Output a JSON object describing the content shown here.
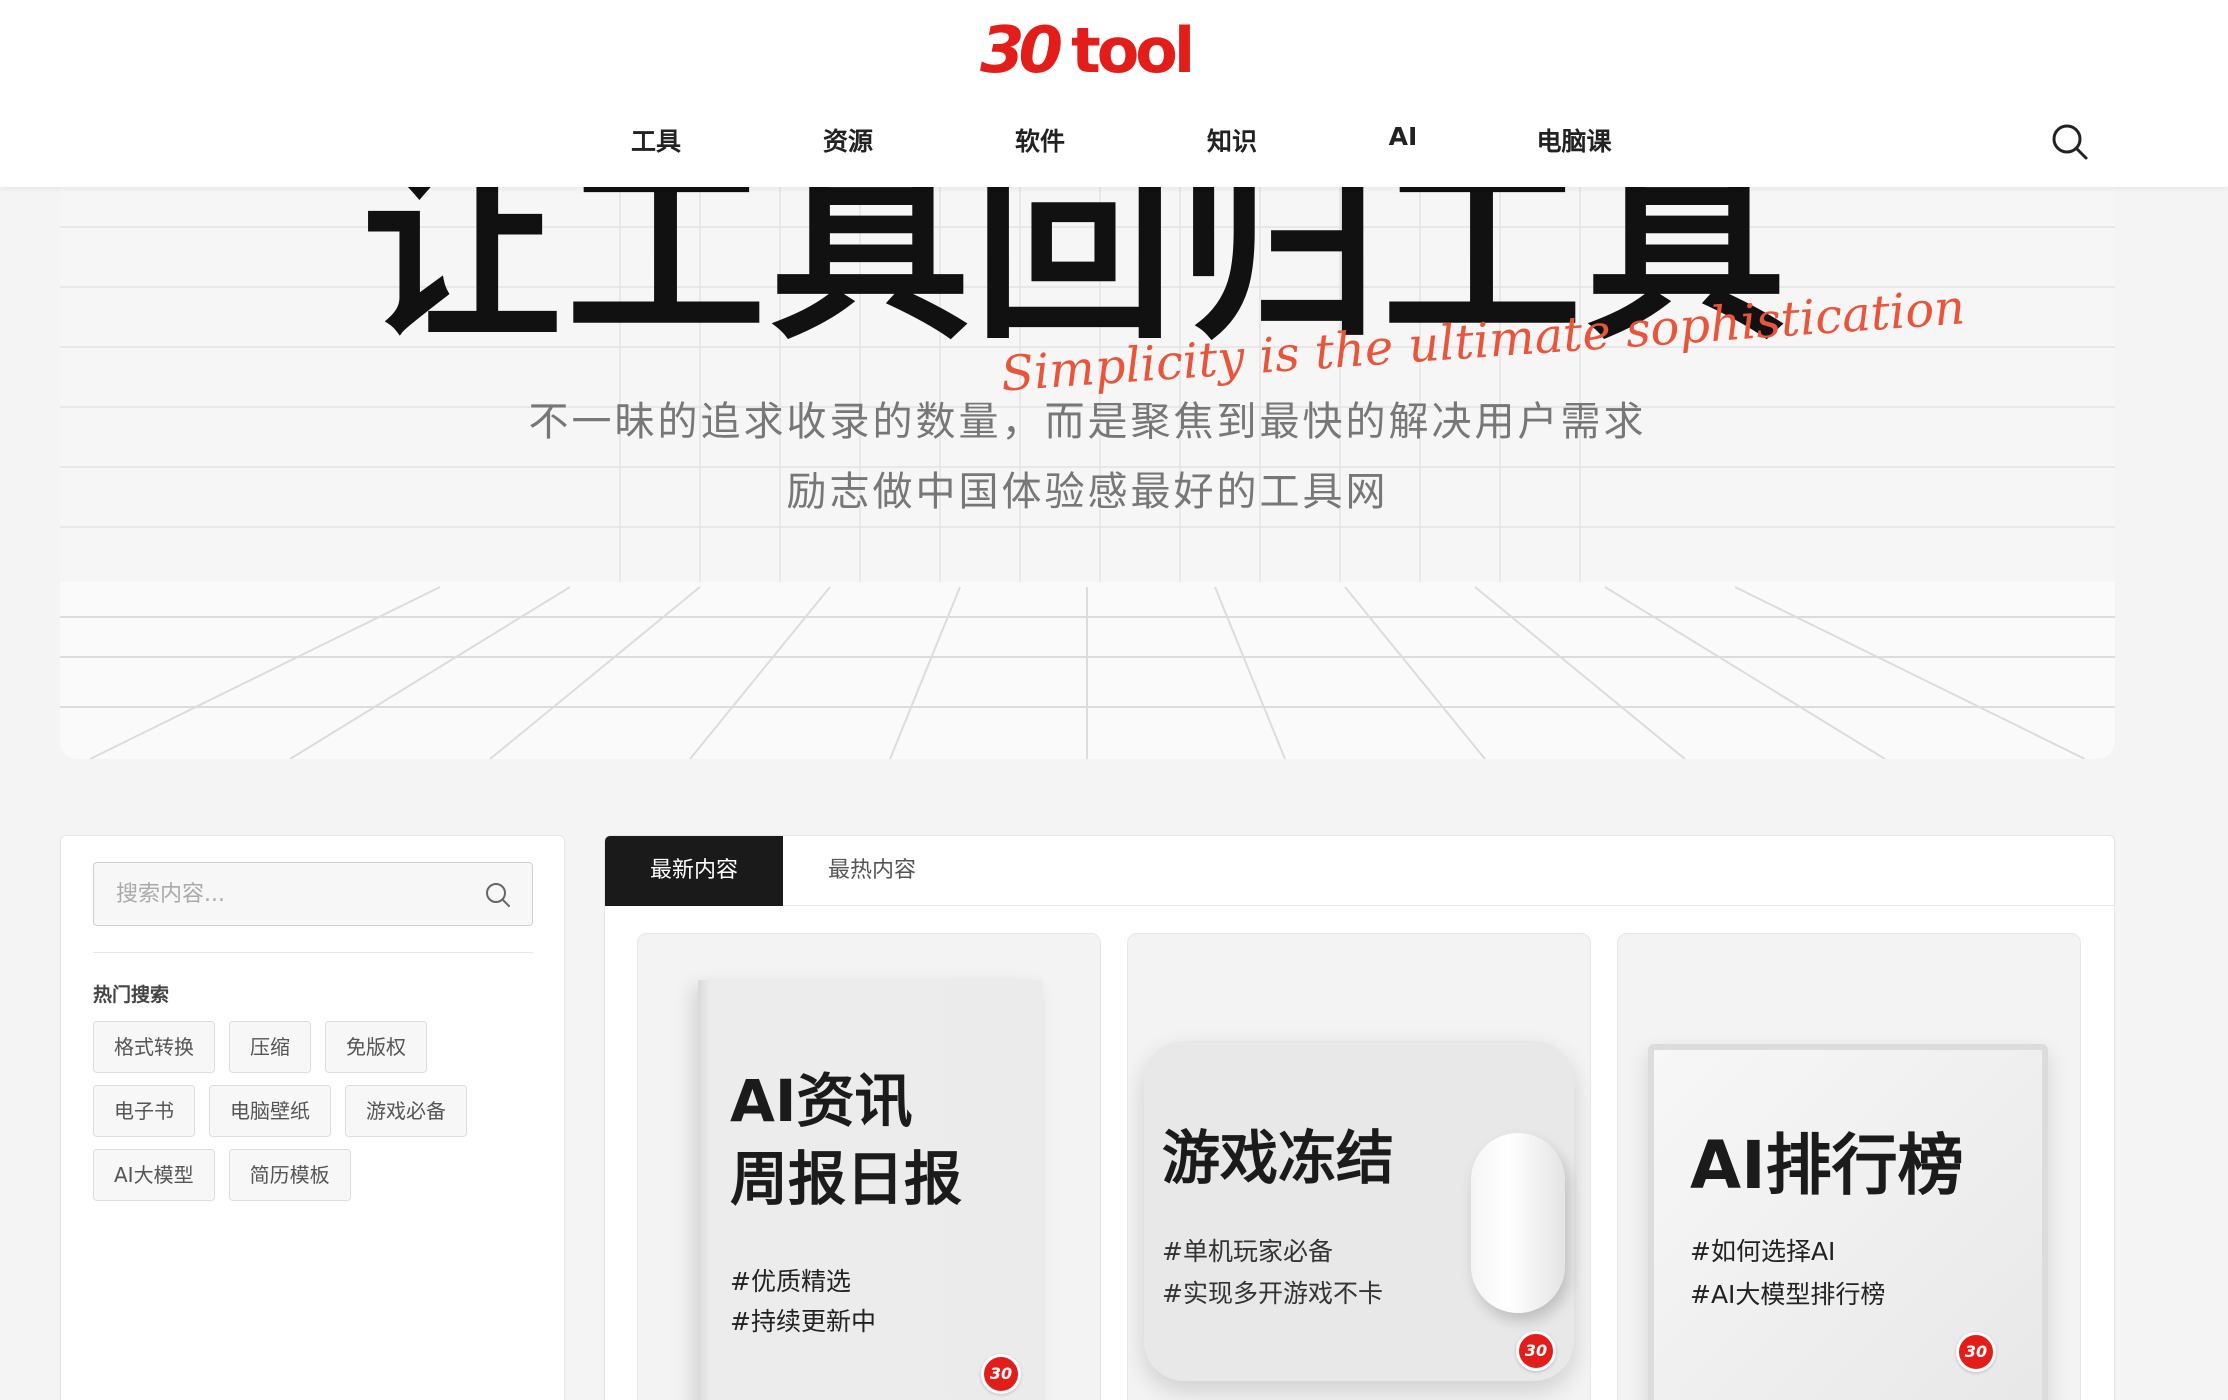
{
  "brand": {
    "logo_number": "30",
    "logo_word": "tool",
    "accent_color": "#e31d1a"
  },
  "nav": {
    "items": [
      {
        "label": "工具"
      },
      {
        "label": "资源"
      },
      {
        "label": "软件"
      },
      {
        "label": "知识"
      },
      {
        "label": "AI"
      },
      {
        "label": "电脑课"
      }
    ],
    "search_icon": "search-icon"
  },
  "hero": {
    "title": "让工具回归工具",
    "script_text": "Simplicity is the ultimate sophistication",
    "line1": "不一昧的追求收录的数量，而是聚焦到最快的解决用户需求",
    "line2": "励志做中国体验感最好的工具网"
  },
  "sidebar": {
    "search_placeholder": "搜索内容...",
    "hot_title": "热门搜索",
    "tags": [
      "格式转换",
      "压缩",
      "免版权",
      "电子书",
      "电脑壁纸",
      "游戏必备",
      "AI大模型",
      "简历模板"
    ]
  },
  "main": {
    "tabs": [
      {
        "label": "最新内容",
        "active": true
      },
      {
        "label": "最热内容",
        "active": false
      }
    ],
    "cards": [
      {
        "title": "AI资讯\n周报日报",
        "tags": "#优质精选\n#持续更新中",
        "badge": "30"
      },
      {
        "title": "游戏冻结",
        "tags": "#单机玩家必备\n#实现多开游戏不卡",
        "badge": "30"
      },
      {
        "title": "AI排行榜",
        "tags": "#如何选择AI\n#AI大模型排行榜",
        "badge": "30"
      }
    ]
  }
}
